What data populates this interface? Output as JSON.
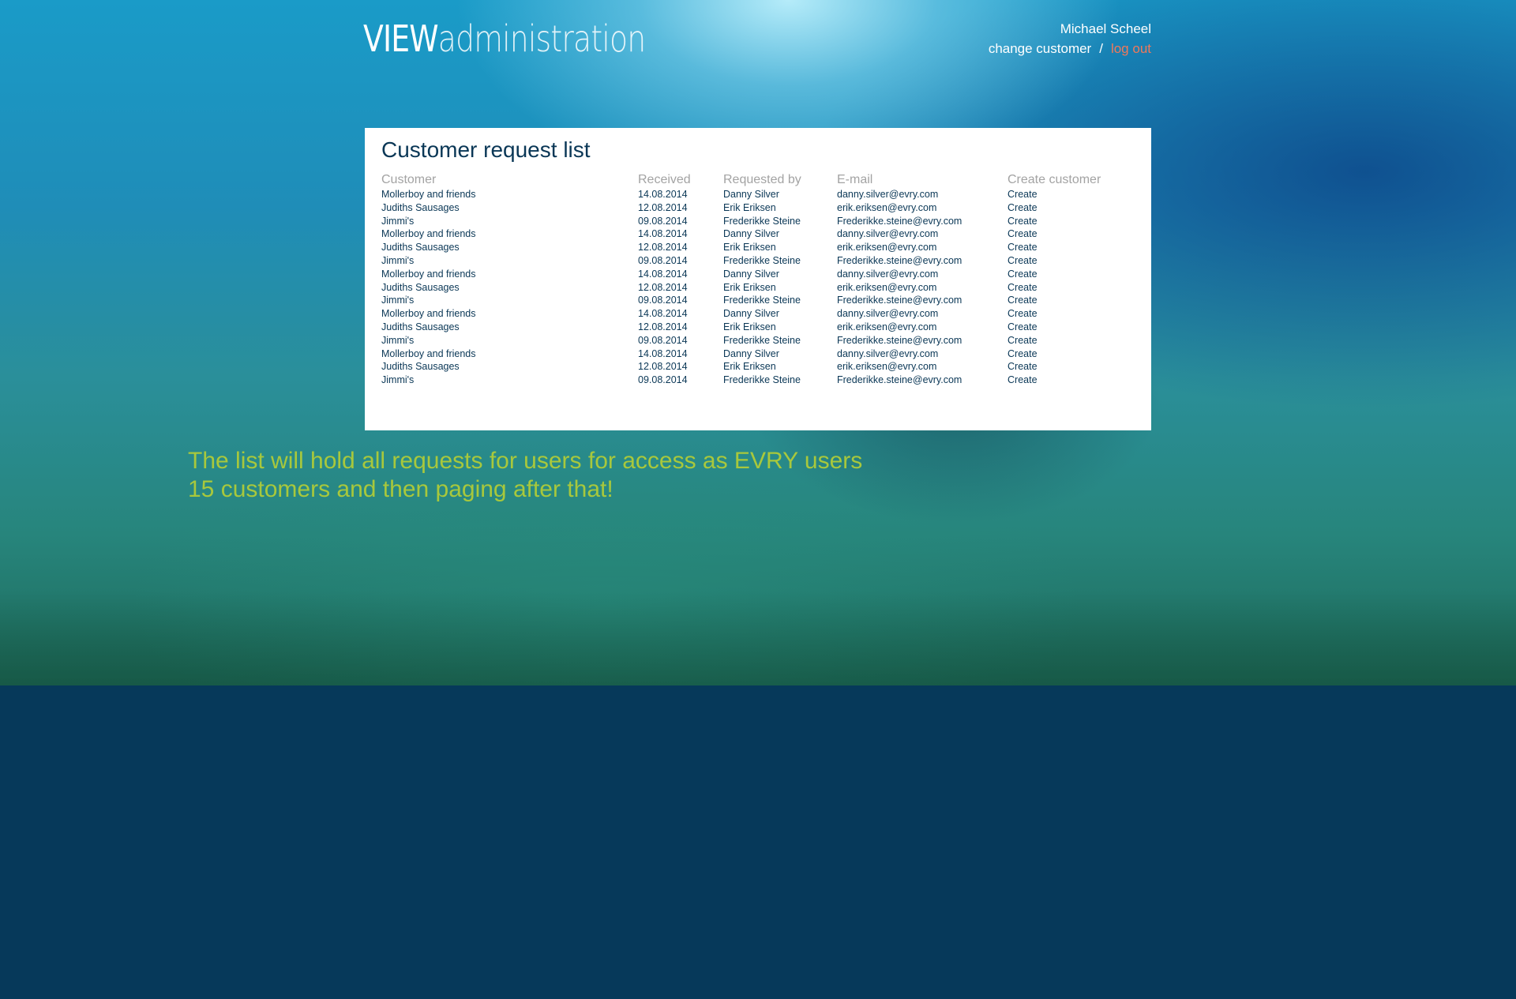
{
  "header": {
    "logo_bold": "VIEW",
    "logo_light": "administration",
    "user_name": "Michael Scheel",
    "change_customer_label": "change customer",
    "separator": "/",
    "logout_label": "log out"
  },
  "panel": {
    "title": "Customer request list",
    "columns": [
      "Customer",
      "Received",
      "Requested by",
      "E-mail",
      "Create customer"
    ],
    "rows": [
      [
        "Mollerboy and friends",
        "14.08.2014",
        "Danny Silver",
        "danny.silver@evry.com",
        "Create"
      ],
      [
        "Judiths Sausages",
        "12.08.2014",
        "Erik Eriksen",
        "erik.eriksen@evry.com",
        "Create"
      ],
      [
        "Jimmi's",
        "09.08.2014",
        "Frederikke Steine",
        "Frederikke.steine@evry.com",
        "Create"
      ],
      [
        "Mollerboy and friends",
        "14.08.2014",
        "Danny Silver",
        "danny.silver@evry.com",
        "Create"
      ],
      [
        "Judiths Sausages",
        "12.08.2014",
        "Erik Eriksen",
        "erik.eriksen@evry.com",
        "Create"
      ],
      [
        "Jimmi's",
        "09.08.2014",
        "Frederikke Steine",
        "Frederikke.steine@evry.com",
        "Create"
      ],
      [
        "Mollerboy and friends",
        "14.08.2014",
        "Danny Silver",
        "danny.silver@evry.com",
        "Create"
      ],
      [
        "Judiths Sausages",
        "12.08.2014",
        "Erik Eriksen",
        "erik.eriksen@evry.com",
        "Create"
      ],
      [
        "Jimmi's",
        "09.08.2014",
        "Frederikke Steine",
        "Frederikke.steine@evry.com",
        "Create"
      ],
      [
        "Mollerboy and friends",
        "14.08.2014",
        "Danny Silver",
        "danny.silver@evry.com",
        "Create"
      ],
      [
        "Judiths Sausages",
        "12.08.2014",
        "Erik Eriksen",
        "erik.eriksen@evry.com",
        "Create"
      ],
      [
        "Jimmi's",
        "09.08.2014",
        "Frederikke Steine",
        "Frederikke.steine@evry.com",
        "Create"
      ],
      [
        "Mollerboy and friends",
        "14.08.2014",
        "Danny Silver",
        "danny.silver@evry.com",
        "Create"
      ],
      [
        "Judiths Sausages",
        "12.08.2014",
        "Erik Eriksen",
        "erik.eriksen@evry.com",
        "Create"
      ],
      [
        "Jimmi's",
        "09.08.2014",
        "Frederikke Steine",
        "Frederikke.steine@evry.com",
        "Create"
      ]
    ]
  },
  "note": {
    "line1": "The list will hold all requests for users for access as EVRY users",
    "line2": "15 customers and then paging after that!"
  },
  "colors": {
    "logout": "#f0785a",
    "note": "#a8c83c",
    "text_dark": "#0a3756",
    "header_gray": "#a3a3a3",
    "page_bottom": "#06395a"
  }
}
